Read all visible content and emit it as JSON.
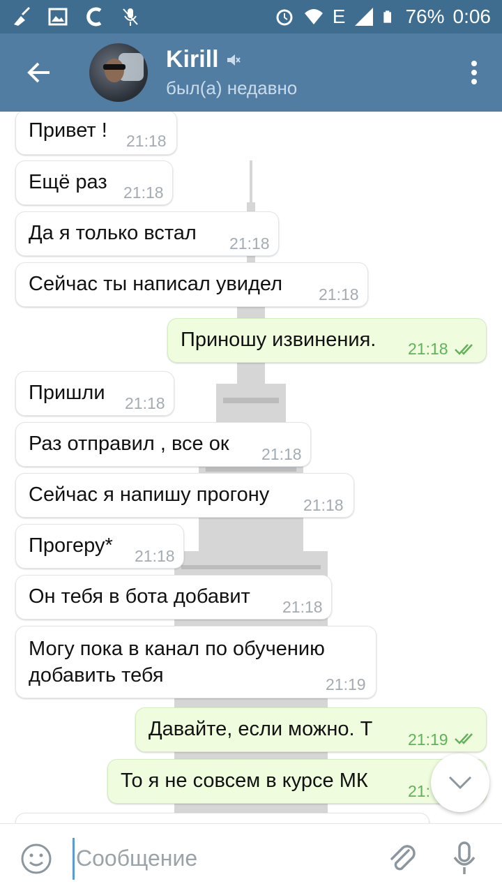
{
  "status_bar": {
    "battery": "76%",
    "time": "0:06",
    "network": "E"
  },
  "header": {
    "contact_name": "Kirill",
    "contact_status": "был(а) недавно"
  },
  "messages": [
    {
      "text": "Привет !",
      "time": "21:18",
      "direction": "in"
    },
    {
      "text": "Ещё раз",
      "time": "21:18",
      "direction": "in"
    },
    {
      "text": "Да я только встал",
      "time": "21:18",
      "direction": "in"
    },
    {
      "text": "Сейчас ты написал увидел",
      "time": "21:18",
      "direction": "in"
    },
    {
      "text": "Приношу извинения.",
      "time": "21:18",
      "direction": "out"
    },
    {
      "text": "Пришли",
      "time": "21:18",
      "direction": "in"
    },
    {
      "text": "Раз отправил , все ок",
      "time": "21:18",
      "direction": "in"
    },
    {
      "text": "Сейчас я напишу прогону",
      "time": "21:18",
      "direction": "in"
    },
    {
      "text": "Прогеру*",
      "time": "21:18",
      "direction": "in"
    },
    {
      "text": "Он тебя в бота добавит",
      "time": "21:18",
      "direction": "in"
    },
    {
      "text_line1": "Могу пока в канал по обучению",
      "text_line2": "добавить тебя",
      "time": "21:19",
      "direction": "in"
    },
    {
      "text": "Давайте, если можно. Т",
      "time": "21:19",
      "direction": "out"
    },
    {
      "text": "То я не совсем в курсе МК",
      "time": "21:",
      "direction": "out"
    }
  ],
  "input": {
    "placeholder": "Сообщение"
  },
  "colors": {
    "status_bar": "#3f6d8f",
    "header": "#517da2",
    "outgoing_bubble": "#effdde",
    "incoming_bubble": "#ffffff",
    "time_out": "#5fb257",
    "time_in": "#a3abb3"
  },
  "icons": {
    "back": "arrow-left-icon",
    "menu": "more-vertical-icon",
    "muted": "muted-speaker-icon",
    "emoji": "smile-icon",
    "attach": "paperclip-icon",
    "mic": "microphone-icon",
    "scroll": "chevron-down-icon",
    "read": "double-check-icon"
  }
}
